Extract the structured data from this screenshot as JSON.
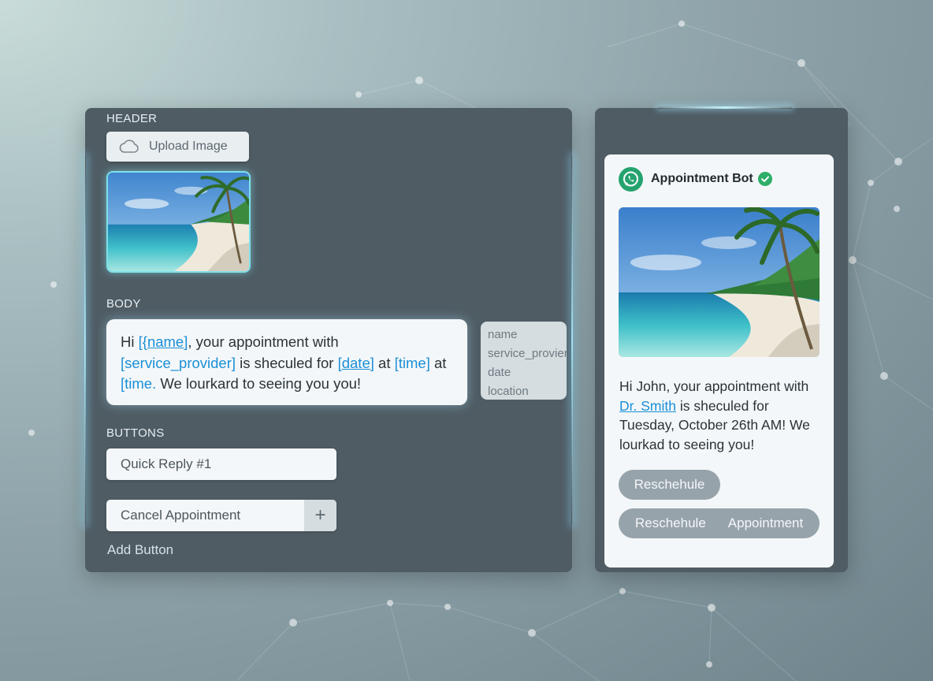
{
  "editor": {
    "header_label": "HEADER",
    "upload_label": "Upload Image",
    "body_label": "BODY",
    "body_text": {
      "p1": "Hi ",
      "v1": "[{name]",
      "p2": ", your appointment with ",
      "v2": "[service_provider]",
      "p3": " is sheculed for ",
      "v3": "[date]",
      "p4": " at ",
      "v4": "[time]",
      "p5": " at ",
      "v5": "[time.",
      "p6": " We lourkard to seeing you you!"
    },
    "variables": [
      "name",
      "service_provier",
      "date",
      "location"
    ],
    "buttons_label": "BUTTONS",
    "button1": "Quick Reply #1",
    "button2": "Cancel Appointment",
    "plus": "+",
    "add_button": "Add Button"
  },
  "preview": {
    "bot_name": "Appointment Bot",
    "msg": {
      "p1": "Hi John, your appointment with ",
      "link": "Dr. Smith",
      "p2": " is sheculed for Tuesday, October 26th AM! We lourkad to seeing you!"
    },
    "chip1": "Reschehule",
    "chip2a": "Reschehule",
    "chip2b": "Appointment"
  },
  "colors": {
    "accent": "#1a8fd6",
    "whatsapp": "#25a36f",
    "panel": "#4f5c64"
  }
}
